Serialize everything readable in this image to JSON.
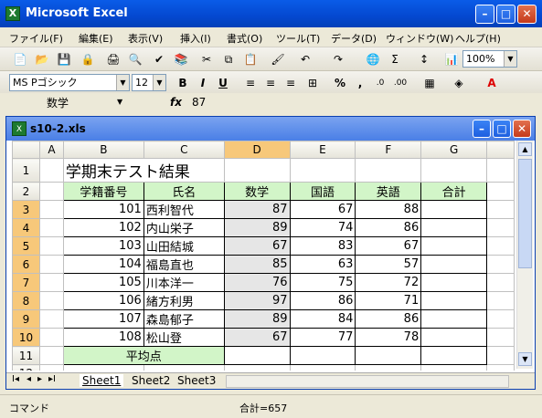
{
  "app": {
    "title": "Microsoft Excel",
    "icon": "X"
  },
  "menus": [
    "ファイル(F)",
    "編集(E)",
    "表示(V)",
    "挿入(I)",
    "書式(O)",
    "ツール(T)",
    "データ(D)",
    "ウィンドウ(W)",
    "ヘルプ(H)"
  ],
  "toolbar": {
    "zoom": "100%",
    "font": "MS Pゴシック",
    "size": "12",
    "bold": "B",
    "italic": "I",
    "underline": "U",
    "percent": "%",
    "comma": ","
  },
  "formula": {
    "name": "数学",
    "fx": "fx",
    "value": "87"
  },
  "workbook": {
    "title": "s10-2.xls"
  },
  "columns": [
    "A",
    "B",
    "C",
    "D",
    "E",
    "F",
    "G"
  ],
  "rows": [
    "1",
    "2",
    "3",
    "4",
    "5",
    "6",
    "7",
    "8",
    "9",
    "10",
    "11",
    "12"
  ],
  "sheet": {
    "title": "学期末テスト結果",
    "headers": [
      "学籍番号",
      "氏名",
      "数学",
      "国語",
      "英語",
      "合計"
    ],
    "data": [
      [
        "101",
        "西利智代",
        "87",
        "67",
        "88"
      ],
      [
        "102",
        "内山栄子",
        "89",
        "74",
        "86"
      ],
      [
        "103",
        "山田結城",
        "67",
        "83",
        "67"
      ],
      [
        "104",
        "福島直也",
        "85",
        "63",
        "57"
      ],
      [
        "105",
        "川本洋一",
        "76",
        "75",
        "72"
      ],
      [
        "106",
        "緒方利男",
        "97",
        "86",
        "71"
      ],
      [
        "107",
        "森島郁子",
        "89",
        "84",
        "86"
      ],
      [
        "108",
        "松山登",
        "67",
        "77",
        "78"
      ]
    ],
    "avg_label": "平均点"
  },
  "tabs": [
    "Sheet1",
    "Sheet2",
    "Sheet3"
  ],
  "status": {
    "mode": "コマンド",
    "sum": "合計=657"
  }
}
